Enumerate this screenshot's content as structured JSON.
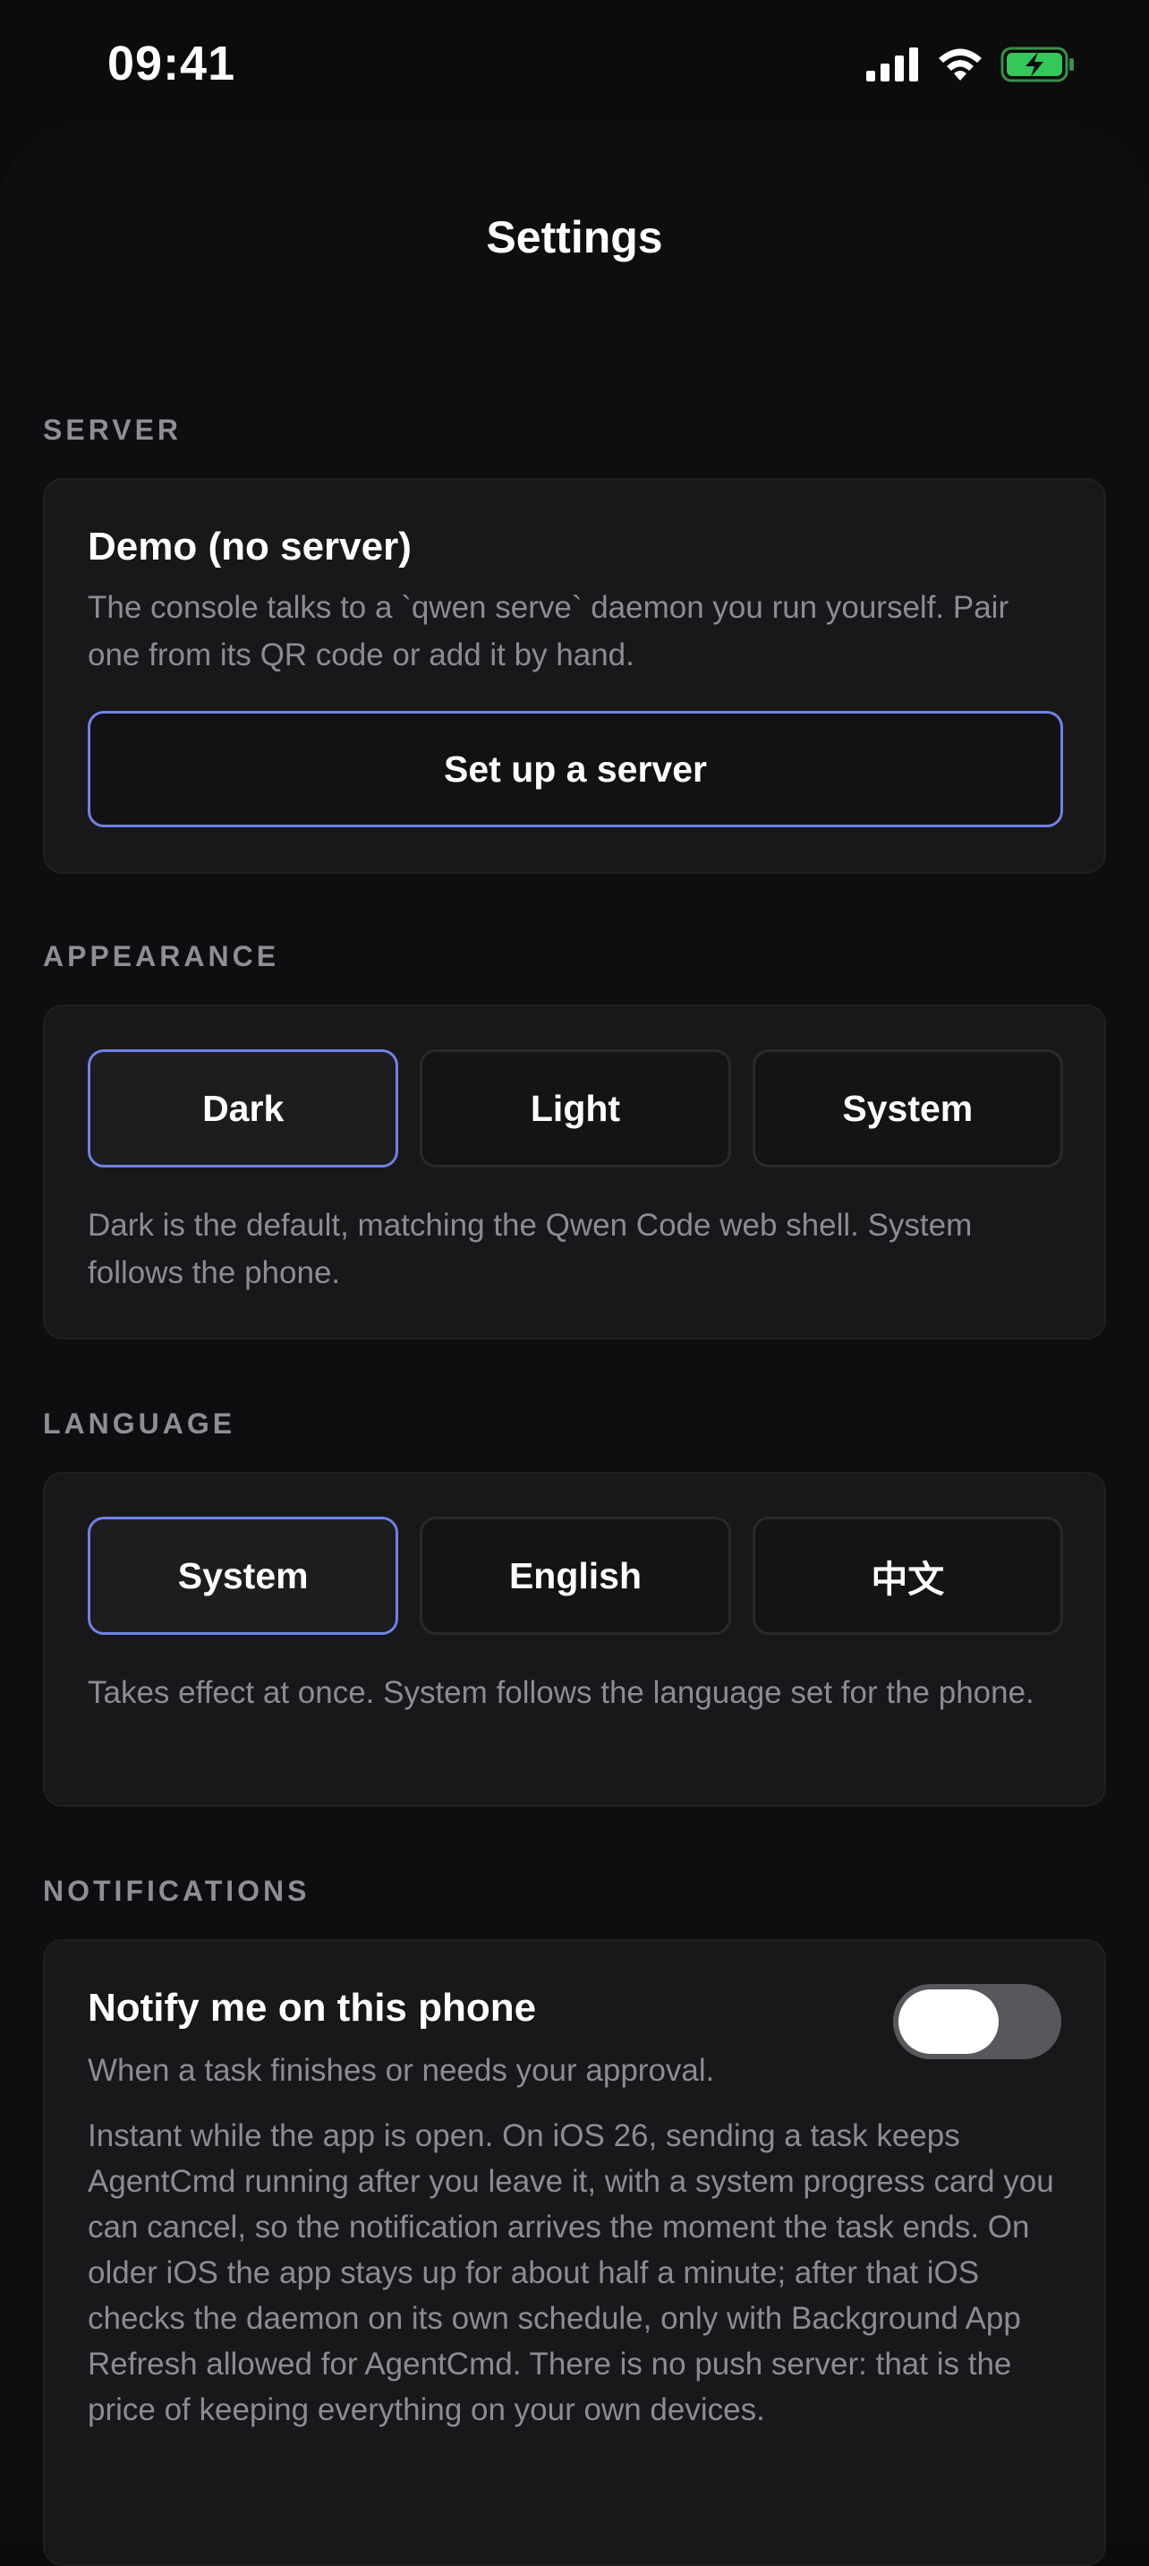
{
  "status": {
    "time": "09:41"
  },
  "nav": {
    "title": "Settings"
  },
  "server": {
    "label": "SERVER",
    "title": "Demo (no server)",
    "description": "The console talks to a `qwen serve` daemon you run yourself. Pair one from its QR code or add it by hand.",
    "button_label": "Set up a server"
  },
  "appearance": {
    "label": "APPEARANCE",
    "options": [
      "Dark",
      "Light",
      "System"
    ],
    "selected": "Dark",
    "description": "Dark is the default, matching the Qwen Code web shell. System follows the phone."
  },
  "language": {
    "label": "LANGUAGE",
    "options": [
      "System",
      "English",
      "中文"
    ],
    "selected": "System",
    "description": "Takes effect at once. System follows the language set for the phone."
  },
  "notifications": {
    "label": "NOTIFICATIONS",
    "title": "Notify me on this phone",
    "subtitle": "When a task finishes or needs your approval.",
    "description": "Instant while the app is open. On iOS 26, sending a task keeps AgentCmd running after you leave it, with a system progress card you can cancel, so the notification arrives the moment the task ends. On older iOS the app stays up for about half a minute; after that iOS checks the daemon on its own schedule, only with Background App Refresh allowed for AgentCmd. There is no push server: that is the price of keeping everything on your own devices.",
    "toggle_on": false
  },
  "colors": {
    "accent": "#6f82e6",
    "card": "#18181a",
    "background": "#0e0e10",
    "muted_text": "#8b8c94",
    "battery": "#34c759"
  },
  "icons": {
    "signal": "cellular-signal-icon",
    "wifi": "wifi-icon",
    "battery": "battery-charging-icon"
  }
}
